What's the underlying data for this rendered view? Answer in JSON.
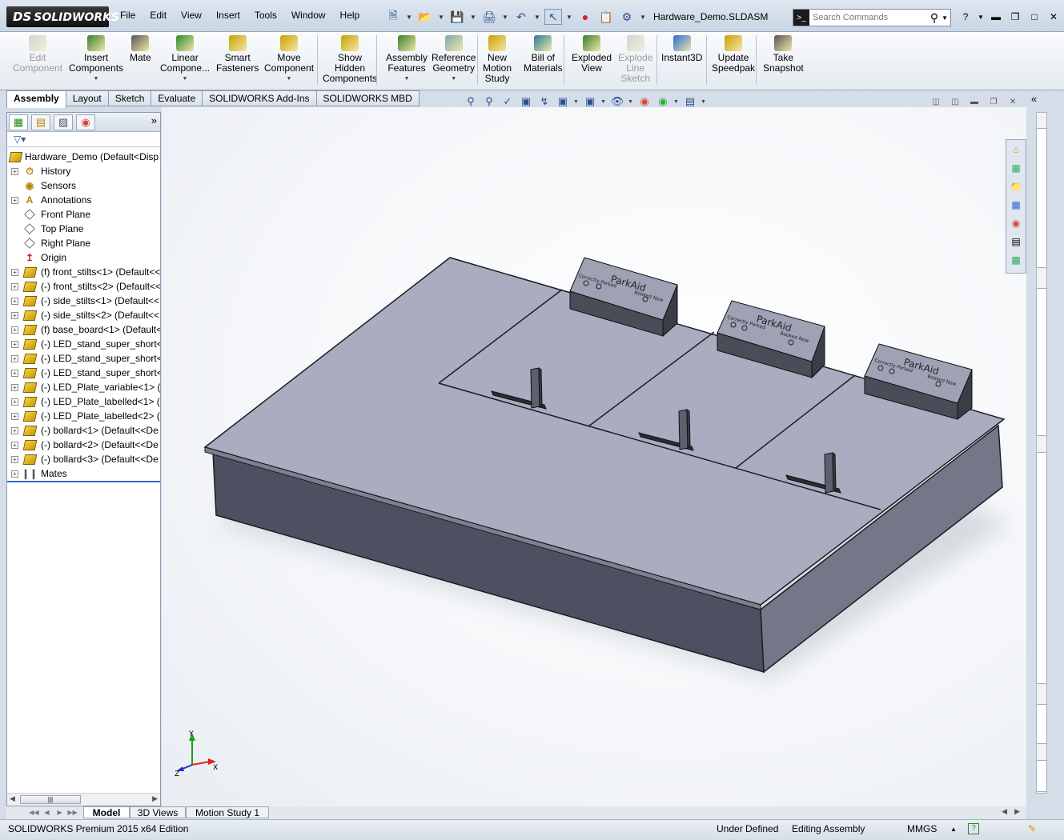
{
  "app": {
    "logo_text": "SOLIDWORKS",
    "document_title": "Hardware_Demo.SLDASM"
  },
  "menus": [
    "File",
    "Edit",
    "View",
    "Insert",
    "Tools",
    "Window",
    "Help"
  ],
  "search": {
    "placeholder": "Search Commands"
  },
  "command_manager": [
    {
      "label": "Edit\nComponent",
      "icon": "edit-component-icon",
      "disabled": true
    },
    {
      "label": "Insert\nComponents",
      "icon": "insert-components-icon",
      "dropdown": true
    },
    {
      "label": "Mate",
      "icon": "mate-icon"
    },
    {
      "label": "Linear\nCompone...",
      "icon": "linear-pattern-icon",
      "dropdown": true
    },
    {
      "label": "Smart\nFasteners",
      "icon": "smart-fasteners-icon"
    },
    {
      "label": "Move\nComponent",
      "icon": "move-component-icon",
      "dropdown": true
    },
    {
      "label": "Show\nHidden\nComponents",
      "icon": "show-hidden-icon"
    },
    {
      "label": "Assembly\nFeatures",
      "icon": "assembly-features-icon",
      "dropdown": true
    },
    {
      "label": "Reference\nGeometry",
      "icon": "reference-geometry-icon",
      "dropdown": true
    },
    {
      "label": "New\nMotion\nStudy",
      "icon": "motion-study-icon"
    },
    {
      "label": "Bill of\nMaterials",
      "icon": "bom-icon"
    },
    {
      "label": "Exploded\nView",
      "icon": "exploded-view-icon"
    },
    {
      "label": "Explode\nLine\nSketch",
      "icon": "explode-line-icon",
      "disabled": true
    },
    {
      "label": "Instant3D",
      "icon": "instant3d-icon"
    },
    {
      "label": "Update\nSpeedpak",
      "icon": "speedpak-icon"
    },
    {
      "label": "Take\nSnapshot",
      "icon": "snapshot-icon"
    }
  ],
  "cmd_tabs": [
    "Assembly",
    "Layout",
    "Sketch",
    "Evaluate",
    "SOLIDWORKS Add-Ins",
    "SOLIDWORKS MBD"
  ],
  "active_cmd_tab": "Assembly",
  "tree": {
    "root": "Hardware_Demo  (Default<Disp",
    "items": [
      {
        "label": "History",
        "icon": "history-icon",
        "expand": true
      },
      {
        "label": "Sensors",
        "icon": "sensors-icon",
        "expand": false
      },
      {
        "label": "Annotations",
        "icon": "annotations-icon",
        "expand": true
      },
      {
        "label": "Front Plane",
        "icon": "plane-icon",
        "expand": false
      },
      {
        "label": "Top Plane",
        "icon": "plane-icon",
        "expand": false
      },
      {
        "label": "Right Plane",
        "icon": "plane-icon",
        "expand": false
      },
      {
        "label": "Origin",
        "icon": "origin-icon",
        "expand": false
      },
      {
        "label": "(f) front_stilts<1> (Default<<",
        "icon": "component-icon",
        "expand": true
      },
      {
        "label": "(-) front_stilts<2> (Default<<",
        "icon": "component-icon",
        "expand": true
      },
      {
        "label": "(-) side_stilts<1> (Default<<",
        "icon": "component-icon",
        "expand": true
      },
      {
        "label": "(-) side_stilts<2> (Default<<",
        "icon": "component-icon",
        "expand": true
      },
      {
        "label": "(f) base_board<1> (Default<",
        "icon": "component-icon",
        "expand": true
      },
      {
        "label": "(-) LED_stand_super_short<1",
        "icon": "component-icon",
        "expand": true
      },
      {
        "label": "(-) LED_stand_super_short<2",
        "icon": "component-icon",
        "expand": true
      },
      {
        "label": "(-) LED_stand_super_short<3",
        "icon": "component-icon",
        "expand": true
      },
      {
        "label": "(-) LED_Plate_variable<1> (D",
        "icon": "component-icon",
        "expand": true
      },
      {
        "label": "(-) LED_Plate_labelled<1> (D",
        "icon": "component-icon",
        "expand": true
      },
      {
        "label": "(-) LED_Plate_labelled<2> (D",
        "icon": "component-icon",
        "expand": true
      },
      {
        "label": "(-) bollard<1> (Default<<De",
        "icon": "component-icon",
        "expand": true
      },
      {
        "label": "(-) bollard<2> (Default<<De",
        "icon": "component-icon",
        "expand": true
      },
      {
        "label": "(-) bollard<3> (Default<<De",
        "icon": "component-icon",
        "expand": true
      },
      {
        "label": "Mates",
        "icon": "mates-icon",
        "expand": true
      }
    ]
  },
  "model_labels": {
    "brand": "ParkAid",
    "left_text": "Correctly Parked",
    "right_text": "Booked Now",
    "left_text_alt": "Correctly Parked"
  },
  "triad": {
    "x": "X",
    "y": "Y",
    "z": "Z"
  },
  "bottom_tabs": [
    "Model",
    "3D Views",
    "Motion Study 1"
  ],
  "active_bottom_tab": "Model",
  "status": {
    "edition": "SOLIDWORKS Premium 2015 x64 Edition",
    "state": "Under Defined",
    "mode": "Editing Assembly",
    "units": "MMGS"
  }
}
